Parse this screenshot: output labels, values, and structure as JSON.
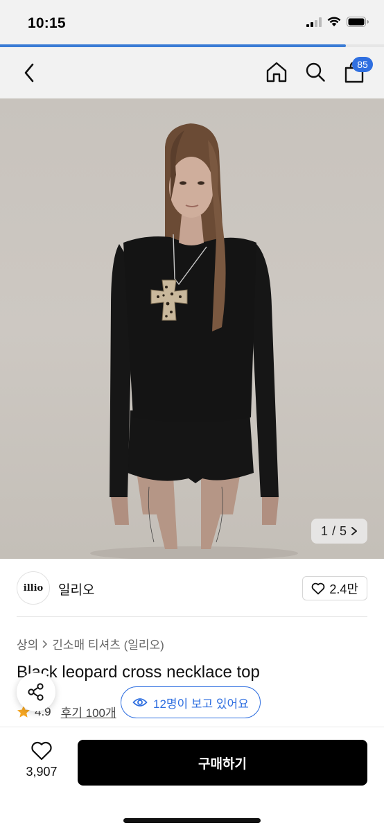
{
  "status": {
    "time": "10:15",
    "icons": [
      "cellular-signal-icon",
      "wifi-icon",
      "battery-icon"
    ]
  },
  "page_progress": 0.9,
  "nav": {
    "icons": [
      "back-arrow-icon",
      "home-icon",
      "search-icon",
      "shopping-bag-icon"
    ],
    "cart_count": "85"
  },
  "gallery": {
    "current": "1",
    "separator": "/",
    "total": "5"
  },
  "brand": {
    "logo_text": "illio",
    "name": "일리오",
    "like_count": "2.4만"
  },
  "breadcrumb": {
    "level1": "상의",
    "level2": "긴소매 티셔츠 (일리오)"
  },
  "product": {
    "title": "Black leopard cross necklace top",
    "rating": "4.9",
    "reviews": "후기 100개"
  },
  "viewers": {
    "text": "12명이 보고 있어요"
  },
  "bottom": {
    "wish_count": "3,907",
    "buy_label": "구매하기"
  },
  "colors": {
    "accent_blue": "#2f6fe0",
    "star": "#f5a623",
    "buy_button": "#000000"
  }
}
